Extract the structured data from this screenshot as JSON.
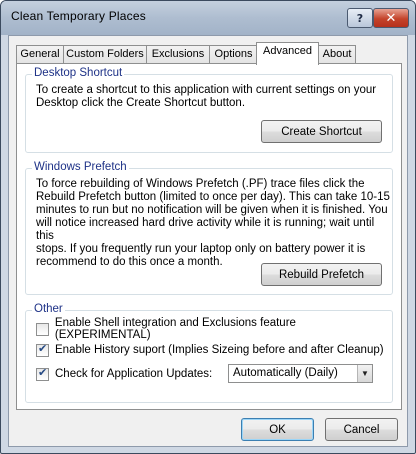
{
  "window": {
    "title": "Clean Temporary Places",
    "help_label": "?",
    "close_label": "✕"
  },
  "tabs": [
    {
      "label": "General"
    },
    {
      "label": "Custom Folders"
    },
    {
      "label": "Exclusions"
    },
    {
      "label": "Options"
    },
    {
      "label": "Advanced",
      "selected": true
    },
    {
      "label": "About"
    }
  ],
  "desktop_shortcut": {
    "title": "Desktop Shortcut",
    "description_lines": [
      "To create a shortcut to this application with current settings on your",
      "Desktop click the Create Shortcut button."
    ],
    "button_label": "Create Shortcut"
  },
  "windows_prefetch": {
    "title": "Windows Prefetch",
    "description_lines": [
      "To force rebuilding of Windows Prefetch (.PF) trace files click the",
      "Rebuild Prefetch button (limited to once per day). This can take 10-15",
      "minutes to run but no notification will be given when it is finished. You",
      "will notice increased hard drive activity while it is running; wait until this",
      "stops. If you frequently run your laptop only on battery power it is",
      "recommend to do this once a month."
    ],
    "button_label": "Rebuild Prefetch"
  },
  "other": {
    "title": "Other",
    "options": [
      {
        "label": "Enable Shell integration and Exclusions feature (EXPERIMENTAL)",
        "checked": false
      },
      {
        "label": "Enable History suport (Implies Sizeing before and after Cleanup)",
        "checked": true
      },
      {
        "label": "Check for Application Updates:",
        "checked": true
      }
    ],
    "update_frequency": {
      "selected": "Automatically (Daily)"
    }
  },
  "footer": {
    "ok_label": "OK",
    "cancel_label": "Cancel"
  }
}
